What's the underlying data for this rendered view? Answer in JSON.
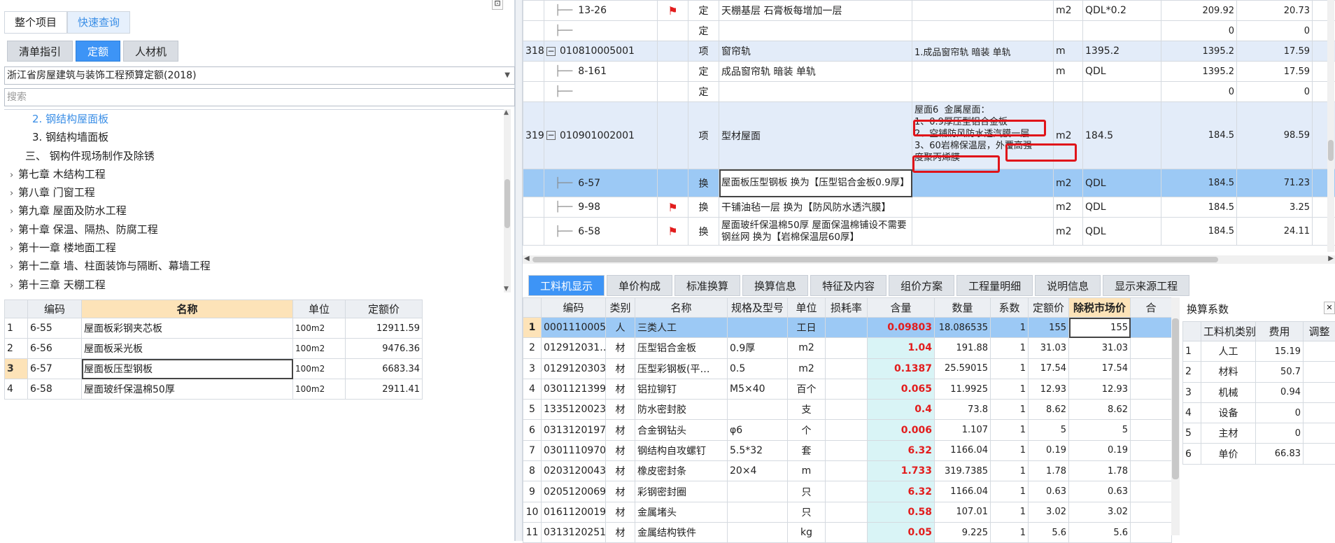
{
  "left": {
    "top_tabs": [
      "整个项目",
      "快速查询"
    ],
    "sub_tabs": [
      "清单指引",
      "定额",
      "人材机"
    ],
    "quota_library": "浙江省房屋建筑与装饰工程预算定额(2018)",
    "search_placeholder": "搜索",
    "tree": [
      {
        "label": "2.  钢结构屋面板",
        "indent": 2,
        "expander": "",
        "selected": true
      },
      {
        "label": "3.  钢结构墙面板",
        "indent": 2,
        "expander": "",
        "selected": false
      },
      {
        "label": "三、 钢构件现场制作及除锈",
        "indent": 1,
        "expander": "",
        "selected": false
      },
      {
        "label": "第七章  木结构工程",
        "indent": 0,
        "expander": "›",
        "selected": false
      },
      {
        "label": "第八章  门窗工程",
        "indent": 0,
        "expander": "›",
        "selected": false
      },
      {
        "label": "第九章  屋面及防水工程",
        "indent": 0,
        "expander": "›",
        "selected": false
      },
      {
        "label": "第十章  保温、隔热、防腐工程",
        "indent": 0,
        "expander": "›",
        "selected": false
      },
      {
        "label": "第十一章  楼地面工程",
        "indent": 0,
        "expander": "›",
        "selected": false
      },
      {
        "label": "第十二章  墙、柱面装饰与隔断、幕墙工程",
        "indent": 0,
        "expander": "›",
        "selected": false
      },
      {
        "label": "第十三章  天棚工程",
        "indent": 0,
        "expander": "›",
        "selected": false
      }
    ],
    "quota_table": {
      "headers": [
        "",
        "编码",
        "名称",
        "单位",
        "定额价"
      ],
      "rows": [
        [
          "1",
          "6-55",
          "屋面板彩钢夹芯板",
          "100m2",
          "12911.59"
        ],
        [
          "2",
          "6-56",
          "屋面板采光板",
          "100m2",
          "9476.36"
        ],
        [
          "3",
          "6-57",
          "屋面板压型钢板",
          "100m2",
          "6683.34"
        ],
        [
          "4",
          "6-58",
          "屋面玻纤保温棉50厚",
          "100m2",
          "2911.41"
        ]
      ]
    }
  },
  "top_grid": {
    "rows": [
      {
        "no": "",
        "code": "13-26",
        "flag": true,
        "type": "定",
        "name": "天棚基层 石膏板每增加一层",
        "feature": "",
        "unit": "m2",
        "expr": "QDL*0.2",
        "qty": "209.92",
        "price": "20.73",
        "kind": "sub"
      },
      {
        "no": "",
        "code": "",
        "flag": false,
        "type": "定",
        "name": "",
        "feature": "",
        "unit": "",
        "expr": "",
        "qty": "0",
        "price": "0",
        "kind": "sub"
      },
      {
        "no": "318",
        "code": "010810005001",
        "flag": false,
        "type": "项",
        "name": "窗帘轨",
        "feature": "1.成品窗帘轨 暗装 单轨",
        "unit": "m",
        "expr": "1395.2",
        "qty": "1395.2",
        "price": "17.59",
        "kind": "proj"
      },
      {
        "no": "",
        "code": "8-161",
        "flag": false,
        "type": "定",
        "name": "成品窗帘轨 暗装 单轨",
        "feature": "",
        "unit": "m",
        "expr": "QDL",
        "qty": "1395.2",
        "price": "17.59",
        "kind": "sub"
      },
      {
        "no": "",
        "code": "",
        "flag": false,
        "type": "定",
        "name": "",
        "feature": "",
        "unit": "",
        "expr": "",
        "qty": "0",
        "price": "0",
        "kind": "sub"
      },
      {
        "no": "319",
        "code": "010901002001",
        "flag": false,
        "type": "项",
        "name": "型材屋面",
        "feature": "屋面6  金属屋面：\n1、0.9厚压型铝合金板\n2、空铺防风防水透汽膜一层\n3、60岩棉保温层，外覆高强\n度聚丙烯膜",
        "unit": "m2",
        "expr": "184.5",
        "qty": "184.5",
        "price": "98.59",
        "kind": "proj tall"
      },
      {
        "no": "",
        "code": "6-57",
        "flag": false,
        "type": "换",
        "name": "屋面板压型钢板  换为【压型铝合金板0.9厚】",
        "feature": "",
        "unit": "m2",
        "expr": "QDL",
        "qty": "184.5",
        "price": "71.23",
        "kind": "selr mid"
      },
      {
        "no": "",
        "code": "9-98",
        "flag": true,
        "type": "换",
        "name": "干铺油毡一层  换为【防风防水透汽膜】",
        "feature": "",
        "unit": "m2",
        "expr": "QDL",
        "qty": "184.5",
        "price": "3.25",
        "kind": "sub"
      },
      {
        "no": "",
        "code": "6-58",
        "flag": true,
        "type": "换",
        "name": "屋面玻纤保温棉50厚  屋面保温棉铺设不需要钢丝网  换为【岩棉保温层60厚】",
        "feature": "",
        "unit": "m2",
        "expr": "QDL",
        "qty": "184.5",
        "price": "24.11",
        "kind": "sub mid"
      }
    ]
  },
  "bottom_tabs": [
    "工料机显示",
    "单价构成",
    "标准换算",
    "换算信息",
    "特征及内容",
    "组价方案",
    "工程量明细",
    "说明信息",
    "显示来源工程"
  ],
  "materials": {
    "headers": [
      "",
      "编码",
      "类别",
      "名称",
      "规格及型号",
      "单位",
      "损耗率",
      "含量",
      "数量",
      "系数",
      "定额价",
      "除税市场价",
      "合"
    ],
    "rows": [
      [
        "1",
        "0001110005",
        "人",
        "三类人工",
        "",
        "工日",
        "",
        "0.09803",
        "18.086535",
        "1",
        "155",
        "155"
      ],
      [
        "2",
        "012912031…",
        "材",
        "压型铝合金板",
        "0.9厚",
        "m2",
        "",
        "1.04",
        "191.88",
        "1",
        "31.03",
        "31.03"
      ],
      [
        "3",
        "0129120303",
        "材",
        "压型彩钢板(平…",
        "0.5",
        "m2",
        "",
        "0.1387",
        "25.59015",
        "1",
        "17.54",
        "17.54"
      ],
      [
        "4",
        "0301121399",
        "材",
        "铝拉铆钉",
        "M5×40",
        "百个",
        "",
        "0.065",
        "11.9925",
        "1",
        "12.93",
        "12.93"
      ],
      [
        "5",
        "1335120023",
        "材",
        "防水密封胶",
        "",
        "支",
        "",
        "0.4",
        "73.8",
        "1",
        "8.62",
        "8.62"
      ],
      [
        "6",
        "0313120197",
        "材",
        "合金钢钻头",
        "φ6",
        "个",
        "",
        "0.006",
        "1.107",
        "1",
        "5",
        "5"
      ],
      [
        "7",
        "0301110970",
        "材",
        "钢结构自攻螺钉",
        "5.5*32",
        "套",
        "",
        "6.32",
        "1166.04",
        "1",
        "0.19",
        "0.19"
      ],
      [
        "8",
        "0203120043",
        "材",
        "橡皮密封条",
        "20×4",
        "m",
        "",
        "1.733",
        "319.7385",
        "1",
        "1.78",
        "1.78"
      ],
      [
        "9",
        "0205120069",
        "材",
        "彩钢密封圈",
        "",
        "只",
        "",
        "6.32",
        "1166.04",
        "1",
        "0.63",
        "0.63"
      ],
      [
        "10",
        "0161120019",
        "材",
        "金属堵头",
        "",
        "只",
        "",
        "0.58",
        "107.01",
        "1",
        "3.02",
        "3.02"
      ],
      [
        "11",
        "0313120251",
        "材",
        "金属结构铁件",
        "",
        "kg",
        "",
        "0.05",
        "9.225",
        "1",
        "5.6",
        "5.6"
      ]
    ]
  },
  "coefficients": {
    "title": "换算系数",
    "headers": [
      "",
      "工料机类别",
      "费用",
      "调整"
    ],
    "rows": [
      [
        "1",
        "人工",
        "15.19"
      ],
      [
        "2",
        "材料",
        "50.7"
      ],
      [
        "3",
        "机械",
        "0.94"
      ],
      [
        "4",
        "设备",
        "0"
      ],
      [
        "5",
        "主材",
        "0"
      ],
      [
        "6",
        "单价",
        "66.83"
      ]
    ]
  },
  "colors": {
    "accent": "#3d94f6",
    "highlight": "#fde3b8",
    "selected_row": "#9cc9f5",
    "flag": "#e21d1d"
  }
}
